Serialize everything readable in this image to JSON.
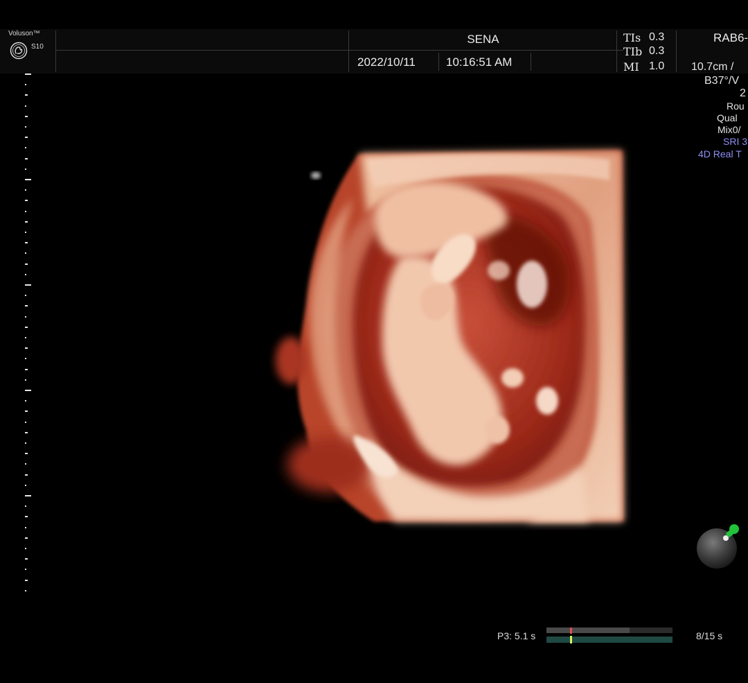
{
  "header": {
    "brand": "Voluson™",
    "model": "S10",
    "patient_name": "SENA",
    "date": "2022/10/11",
    "time": "10:16:51 AM",
    "probe": "RAB6-"
  },
  "indices": [
    {
      "label": "TIs",
      "value": "0.3"
    },
    {
      "label": "TIb",
      "value": "0.3"
    },
    {
      "label": "MI",
      "value": "1.0"
    }
  ],
  "params": {
    "depth_freq": "10.7cm /",
    "angle": "B37°/V",
    "value_2": "2",
    "preset": "Rou",
    "quality": "Qual",
    "mix": "Mix0/",
    "sri": "SRI 3",
    "mode": "4D Real T"
  },
  "cine": {
    "label": "P3:  5.1 s",
    "frames": "8/15 s",
    "top_fill": 0.66,
    "position": 0.19
  },
  "colors": {
    "background": "#000000",
    "header": "#0b0b0b",
    "mode_blue": "#8f8ff5",
    "cine_green": "#1f4a44",
    "marker_red": "#e05050",
    "marker_yellow": "#d8f060",
    "ball_green": "#22c23a"
  }
}
